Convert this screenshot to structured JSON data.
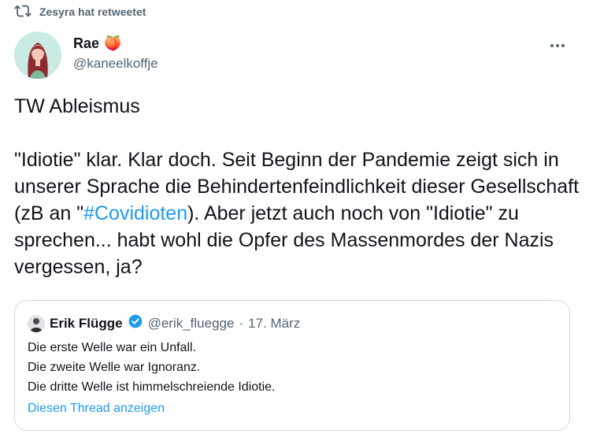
{
  "retweet": {
    "label": "Zesyra hat retweetet",
    "icon": "retweet-icon"
  },
  "author": {
    "name": "Rae",
    "emoji": "🍑",
    "handle": "@kaneelkoffje",
    "avatar": "avatar-illustration"
  },
  "more_icon": "more-dots-icon",
  "tweet": {
    "line1": "TW Ableismus",
    "para_before": "\"Idiotie\" klar. Klar doch. Seit Beginn der Pandemie zeigt sich in unserer Sprache die Behindertenfeindlichkeit dieser Gesellschaft (zB an \"",
    "hashtag": "#Covidioten",
    "para_after": "). Aber jetzt auch noch von \"Idiotie\" zu sprechen... habt wohl die Opfer des Massenmordes der Nazis vergessen, ja?"
  },
  "quote": {
    "name": "Erik Flügge",
    "verified_icon": "verified-badge-icon",
    "handle": "@erik_fluegge",
    "separator": "·",
    "date": "17. März",
    "lines": [
      "Die erste Welle war ein Unfall.",
      "Die zweite Welle war Ignoranz.",
      "Die dritte Welle ist himmelschreiende Idiotie."
    ],
    "show_thread": "Diesen Thread anzeigen"
  },
  "colors": {
    "accent": "#1d9bf0",
    "muted": "#536471",
    "text": "#0f1419",
    "border": "#cfd9de"
  }
}
